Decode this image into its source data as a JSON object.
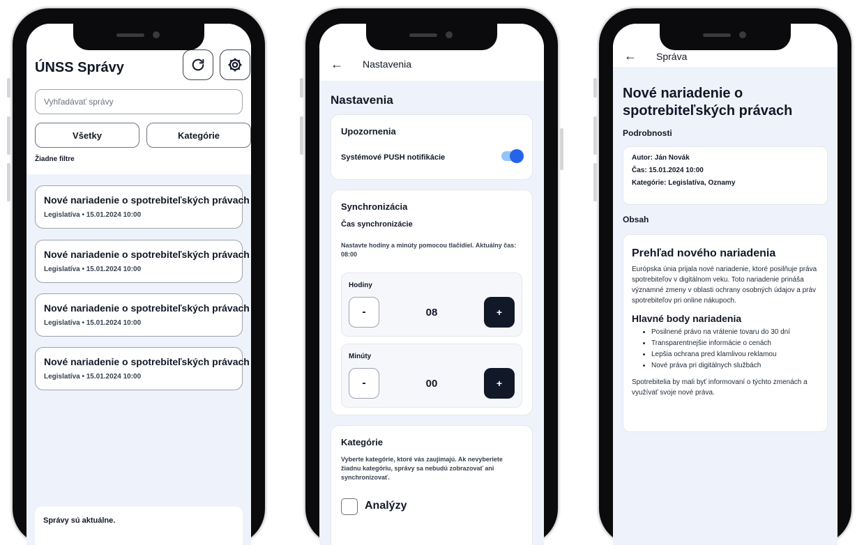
{
  "phone1": {
    "title": "ÚNSS Správy",
    "refresh_icon": "refresh-icon",
    "settings_icon": "gear-icon",
    "search_placeholder": "Vyhľadávať správy",
    "filter_all": "Všetky",
    "filter_categories": "Kategórie",
    "filters_status": "Žiadne filtre",
    "news": [
      {
        "title": "Nové nariadenie o spotrebiteľských právach",
        "meta": "Legislatíva • 15.01.2024 10:00"
      },
      {
        "title": "Nové nariadenie o spotrebiteľských právach",
        "meta": "Legislatíva • 15.01.2024 10:00"
      },
      {
        "title": "Nové nariadenie o spotrebiteľských právach",
        "meta": "Legislatíva • 15.01.2024 10:00"
      },
      {
        "title": "Nové nariadenie o spotrebiteľských právach",
        "meta": "Legislatíva • 15.01.2024 10:00"
      }
    ],
    "status_text": "Správy sú aktuálne."
  },
  "phone2": {
    "header_title": "Nastavenia",
    "page_title": "Nastavenia",
    "notifications": {
      "title": "Upozornenia",
      "push_label": "Systémové PUSH notifikácie",
      "push_enabled": true
    },
    "sync": {
      "title": "Synchronizácia",
      "subtitle": "Čas synchronizácie",
      "description": "Nastavte hodiny a minúty pomocou tlačidiel. Aktuálny čas: 08:00",
      "hours_label": "Hodiny",
      "hours_value": "08",
      "minutes_label": "Minúty",
      "minutes_value": "00",
      "minus_label": "-",
      "plus_label": "+"
    },
    "categories": {
      "title": "Kategórie",
      "description": "Vyberte kategórie, ktoré vás zaujímajú. Ak nevyberiete žiadnu kategóriu, správy sa nebudú zobrazovať ani synchronizovať.",
      "first_option": "Analýzy",
      "first_checked": false
    }
  },
  "phone3": {
    "header_title": "Správa",
    "article_title": "Nové nariadenie o spotrebiteľských právach",
    "details_heading": "Podrobnosti",
    "author": "Autor: Ján Novák",
    "time": "Čas: 15.01.2024 10:00",
    "category": "Kategórie: Legislatíva, Oznamy",
    "content_heading": "Obsah",
    "content": {
      "h2": "Prehľad nového nariadenia",
      "intro": "Európska únia prijala nové nariadenie, ktoré posilňuje práva spotrebiteľov v digitálnom veku. Toto nariadenie prináša významné zmeny v oblasti ochrany osobných údajov a práv spotrebiteľov pri online nákupoch.",
      "h3": "Hlavné body nariadenia",
      "points": [
        "Posilnené právo na vrátenie tovaru do 30 dní",
        "Transparentnejšie informácie o cenách",
        "Lepšia ochrana pred klamlivou reklamou",
        "Nové práva pri digitálnych službách"
      ],
      "outro": "Spotrebitelia by mali byť informovaní o týchto zmenách a využívať svoje nové práva."
    }
  },
  "back_icon": "arrow-left-icon"
}
